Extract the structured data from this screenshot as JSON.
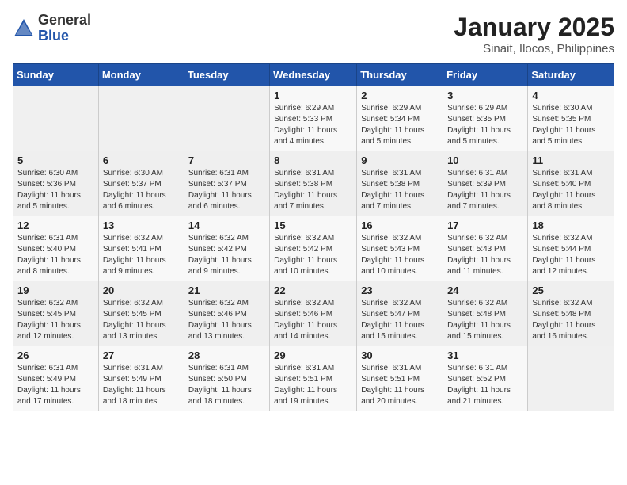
{
  "logo": {
    "general": "General",
    "blue": "Blue"
  },
  "title": "January 2025",
  "location": "Sinait, Ilocos, Philippines",
  "weekdays": [
    "Sunday",
    "Monday",
    "Tuesday",
    "Wednesday",
    "Thursday",
    "Friday",
    "Saturday"
  ],
  "weeks": [
    [
      {
        "day": "",
        "sunrise": "",
        "sunset": "",
        "daylight": ""
      },
      {
        "day": "",
        "sunrise": "",
        "sunset": "",
        "daylight": ""
      },
      {
        "day": "",
        "sunrise": "",
        "sunset": "",
        "daylight": ""
      },
      {
        "day": "1",
        "sunrise": "Sunrise: 6:29 AM",
        "sunset": "Sunset: 5:33 PM",
        "daylight": "Daylight: 11 hours and 4 minutes."
      },
      {
        "day": "2",
        "sunrise": "Sunrise: 6:29 AM",
        "sunset": "Sunset: 5:34 PM",
        "daylight": "Daylight: 11 hours and 5 minutes."
      },
      {
        "day": "3",
        "sunrise": "Sunrise: 6:29 AM",
        "sunset": "Sunset: 5:35 PM",
        "daylight": "Daylight: 11 hours and 5 minutes."
      },
      {
        "day": "4",
        "sunrise": "Sunrise: 6:30 AM",
        "sunset": "Sunset: 5:35 PM",
        "daylight": "Daylight: 11 hours and 5 minutes."
      }
    ],
    [
      {
        "day": "5",
        "sunrise": "Sunrise: 6:30 AM",
        "sunset": "Sunset: 5:36 PM",
        "daylight": "Daylight: 11 hours and 5 minutes."
      },
      {
        "day": "6",
        "sunrise": "Sunrise: 6:30 AM",
        "sunset": "Sunset: 5:37 PM",
        "daylight": "Daylight: 11 hours and 6 minutes."
      },
      {
        "day": "7",
        "sunrise": "Sunrise: 6:31 AM",
        "sunset": "Sunset: 5:37 PM",
        "daylight": "Daylight: 11 hours and 6 minutes."
      },
      {
        "day": "8",
        "sunrise": "Sunrise: 6:31 AM",
        "sunset": "Sunset: 5:38 PM",
        "daylight": "Daylight: 11 hours and 7 minutes."
      },
      {
        "day": "9",
        "sunrise": "Sunrise: 6:31 AM",
        "sunset": "Sunset: 5:38 PM",
        "daylight": "Daylight: 11 hours and 7 minutes."
      },
      {
        "day": "10",
        "sunrise": "Sunrise: 6:31 AM",
        "sunset": "Sunset: 5:39 PM",
        "daylight": "Daylight: 11 hours and 7 minutes."
      },
      {
        "day": "11",
        "sunrise": "Sunrise: 6:31 AM",
        "sunset": "Sunset: 5:40 PM",
        "daylight": "Daylight: 11 hours and 8 minutes."
      }
    ],
    [
      {
        "day": "12",
        "sunrise": "Sunrise: 6:31 AM",
        "sunset": "Sunset: 5:40 PM",
        "daylight": "Daylight: 11 hours and 8 minutes."
      },
      {
        "day": "13",
        "sunrise": "Sunrise: 6:32 AM",
        "sunset": "Sunset: 5:41 PM",
        "daylight": "Daylight: 11 hours and 9 minutes."
      },
      {
        "day": "14",
        "sunrise": "Sunrise: 6:32 AM",
        "sunset": "Sunset: 5:42 PM",
        "daylight": "Daylight: 11 hours and 9 minutes."
      },
      {
        "day": "15",
        "sunrise": "Sunrise: 6:32 AM",
        "sunset": "Sunset: 5:42 PM",
        "daylight": "Daylight: 11 hours and 10 minutes."
      },
      {
        "day": "16",
        "sunrise": "Sunrise: 6:32 AM",
        "sunset": "Sunset: 5:43 PM",
        "daylight": "Daylight: 11 hours and 10 minutes."
      },
      {
        "day": "17",
        "sunrise": "Sunrise: 6:32 AM",
        "sunset": "Sunset: 5:43 PM",
        "daylight": "Daylight: 11 hours and 11 minutes."
      },
      {
        "day": "18",
        "sunrise": "Sunrise: 6:32 AM",
        "sunset": "Sunset: 5:44 PM",
        "daylight": "Daylight: 11 hours and 12 minutes."
      }
    ],
    [
      {
        "day": "19",
        "sunrise": "Sunrise: 6:32 AM",
        "sunset": "Sunset: 5:45 PM",
        "daylight": "Daylight: 11 hours and 12 minutes."
      },
      {
        "day": "20",
        "sunrise": "Sunrise: 6:32 AM",
        "sunset": "Sunset: 5:45 PM",
        "daylight": "Daylight: 11 hours and 13 minutes."
      },
      {
        "day": "21",
        "sunrise": "Sunrise: 6:32 AM",
        "sunset": "Sunset: 5:46 PM",
        "daylight": "Daylight: 11 hours and 13 minutes."
      },
      {
        "day": "22",
        "sunrise": "Sunrise: 6:32 AM",
        "sunset": "Sunset: 5:46 PM",
        "daylight": "Daylight: 11 hours and 14 minutes."
      },
      {
        "day": "23",
        "sunrise": "Sunrise: 6:32 AM",
        "sunset": "Sunset: 5:47 PM",
        "daylight": "Daylight: 11 hours and 15 minutes."
      },
      {
        "day": "24",
        "sunrise": "Sunrise: 6:32 AM",
        "sunset": "Sunset: 5:48 PM",
        "daylight": "Daylight: 11 hours and 15 minutes."
      },
      {
        "day": "25",
        "sunrise": "Sunrise: 6:32 AM",
        "sunset": "Sunset: 5:48 PM",
        "daylight": "Daylight: 11 hours and 16 minutes."
      }
    ],
    [
      {
        "day": "26",
        "sunrise": "Sunrise: 6:31 AM",
        "sunset": "Sunset: 5:49 PM",
        "daylight": "Daylight: 11 hours and 17 minutes."
      },
      {
        "day": "27",
        "sunrise": "Sunrise: 6:31 AM",
        "sunset": "Sunset: 5:49 PM",
        "daylight": "Daylight: 11 hours and 18 minutes."
      },
      {
        "day": "28",
        "sunrise": "Sunrise: 6:31 AM",
        "sunset": "Sunset: 5:50 PM",
        "daylight": "Daylight: 11 hours and 18 minutes."
      },
      {
        "day": "29",
        "sunrise": "Sunrise: 6:31 AM",
        "sunset": "Sunset: 5:51 PM",
        "daylight": "Daylight: 11 hours and 19 minutes."
      },
      {
        "day": "30",
        "sunrise": "Sunrise: 6:31 AM",
        "sunset": "Sunset: 5:51 PM",
        "daylight": "Daylight: 11 hours and 20 minutes."
      },
      {
        "day": "31",
        "sunrise": "Sunrise: 6:31 AM",
        "sunset": "Sunset: 5:52 PM",
        "daylight": "Daylight: 11 hours and 21 minutes."
      },
      {
        "day": "",
        "sunrise": "",
        "sunset": "",
        "daylight": ""
      }
    ]
  ]
}
